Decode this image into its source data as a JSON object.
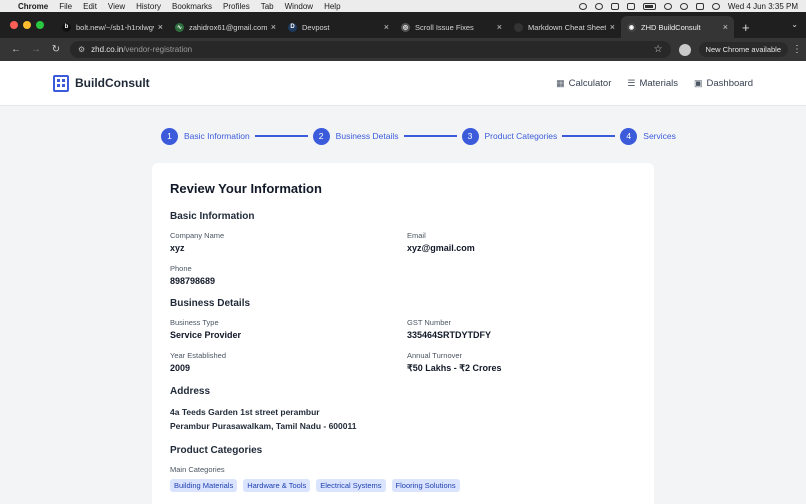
{
  "menubar": {
    "app": "Chrome",
    "items": [
      "File",
      "Edit",
      "View",
      "History",
      "Bookmarks",
      "Profiles",
      "Tab",
      "Window",
      "Help"
    ],
    "datetime": "Wed 4 Jun  3:35 PM"
  },
  "tabs": [
    {
      "title": "bolt.new/~/sb1-h1rxlwgv",
      "favicon": "b",
      "fav_color": "#111111",
      "close": "×"
    },
    {
      "title": "zahidrox61@gmail.com",
      "favicon": "∿",
      "fav_color": "#2f6f3e",
      "close": "×"
    },
    {
      "title": "Devpost",
      "favicon": "D",
      "fav_color": "#1e3a5f",
      "close": "×"
    },
    {
      "title": "Scroll Issue Fixes",
      "favicon": "◎",
      "fav_color": "#555555",
      "close": "×"
    },
    {
      "title": "Markdown Cheat Sheet",
      "favicon": "",
      "fav_color": "#333333",
      "close": "×"
    },
    {
      "title": "ZHD BuildConsult",
      "favicon": "◉",
      "fav_color": "#444444",
      "close": "×",
      "active": true
    }
  ],
  "newtab_label": "+",
  "address": {
    "domain": "zhd.co.in",
    "path": "/vendor-registration",
    "update_label": "New Chrome available"
  },
  "site": {
    "brand": "BuildConsult",
    "nav": [
      {
        "label": "Calculator",
        "icon": "calculator-icon",
        "glyph": "▦"
      },
      {
        "label": "Materials",
        "icon": "list-icon",
        "glyph": "☰"
      },
      {
        "label": "Dashboard",
        "icon": "dashboard-icon",
        "glyph": "▣"
      }
    ]
  },
  "steps": [
    {
      "num": "1",
      "label": "Basic Information"
    },
    {
      "num": "2",
      "label": "Business Details"
    },
    {
      "num": "3",
      "label": "Product Categories"
    },
    {
      "num": "4",
      "label": "Services"
    }
  ],
  "review": {
    "title": "Review Your Information",
    "basic": {
      "heading": "Basic Information",
      "company_label": "Company Name",
      "company_value": "xyz",
      "email_label": "Email",
      "email_value": "xyz@gmail.com",
      "phone_label": "Phone",
      "phone_value": "898798689"
    },
    "business": {
      "heading": "Business Details",
      "type_label": "Business Type",
      "type_value": "Service Provider",
      "gst_label": "GST Number",
      "gst_value": "335464SRTDYTDFY",
      "year_label": "Year Established",
      "year_value": "2009",
      "turnover_label": "Annual Turnover",
      "turnover_value": "₹50 Lakhs - ₹2 Crores"
    },
    "address": {
      "heading": "Address",
      "line1": "4a Teeds Garden 1st street perambur",
      "line2": "Perambur Purasawalkam, Tamil Nadu - 600011"
    },
    "categories": {
      "heading": "Product Categories",
      "main_label": "Main Categories",
      "tags": [
        "Building Materials",
        "Hardware & Tools",
        "Electrical Systems",
        "Flooring Solutions"
      ]
    }
  },
  "colors": {
    "accent": "#3b5bdb",
    "tag_bg": "#dbe4ff"
  }
}
